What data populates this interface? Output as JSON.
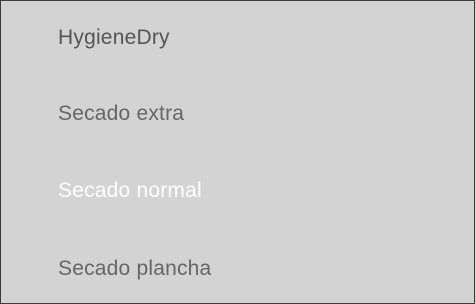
{
  "menu": {
    "items": [
      {
        "label": "HygieneDry",
        "state": "default"
      },
      {
        "label": "Secado extra",
        "state": "default"
      },
      {
        "label": "Secado normal",
        "state": "selected"
      },
      {
        "label": "Secado plancha",
        "state": "default"
      }
    ]
  },
  "colors": {
    "background": "#d3d3d3",
    "text": "#666666",
    "selected_text": "#ffffff",
    "border": "#3a3a3a"
  }
}
